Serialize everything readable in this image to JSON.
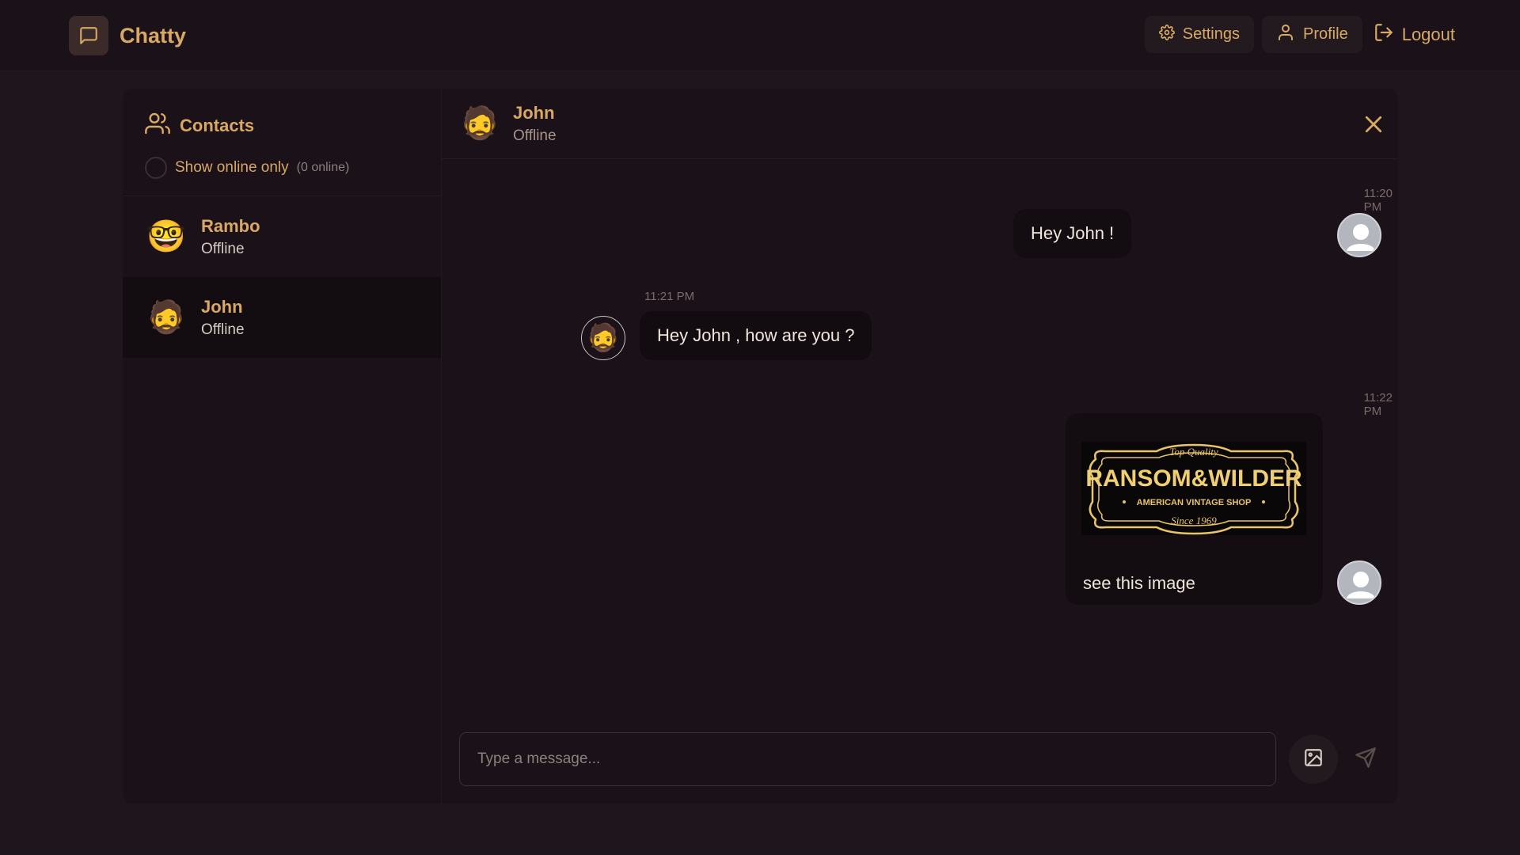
{
  "app": {
    "name": "Chatty"
  },
  "nav": {
    "settings": "Settings",
    "profile": "Profile",
    "logout": "Logout"
  },
  "sidebar": {
    "title": "Contacts",
    "filter_label": "Show online only",
    "online_count": "(0 online)",
    "contacts": [
      {
        "name": "Rambo",
        "status": "Offline",
        "avatar": "🤓"
      },
      {
        "name": "John",
        "status": "Offline",
        "avatar": "🧔"
      }
    ]
  },
  "chat": {
    "contact_name": "John",
    "contact_status": "Offline",
    "messages": [
      {
        "time": "11:20 PM",
        "text": "Hey John !",
        "direction": "outgoing"
      },
      {
        "time": "11:21 PM",
        "text": "Hey John , how are you ?",
        "direction": "incoming"
      },
      {
        "time": "11:22 PM",
        "text": "see this image",
        "direction": "outgoing",
        "has_image": true
      }
    ],
    "image_logo": {
      "top_text": "Top Quality",
      "main_text": "RANSOM&WILDER",
      "sub_text": "AMERICAN VINTAGE SHOP",
      "since_text": "Since 1969"
    },
    "input_placeholder": "Type a message..."
  },
  "colors": {
    "accent": "#d9a865",
    "background": "#1e161c",
    "panel": "#1a1218"
  }
}
